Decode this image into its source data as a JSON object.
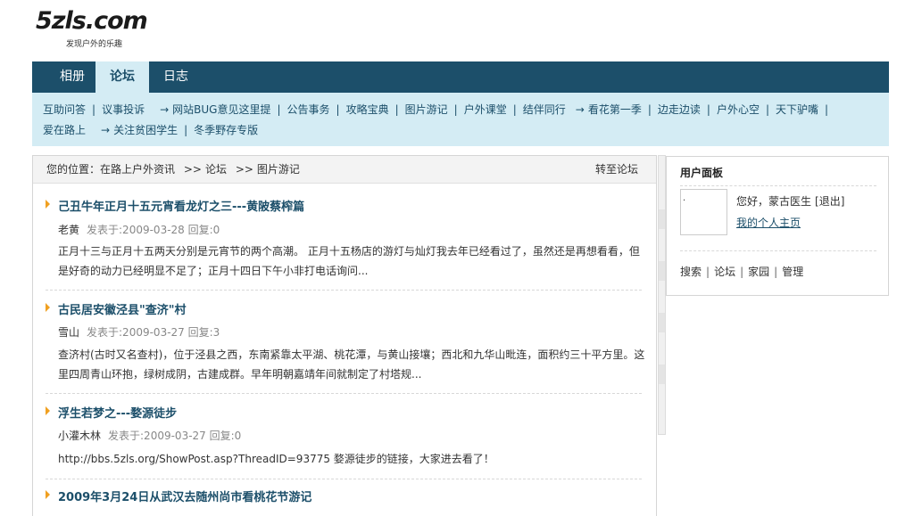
{
  "logo": {
    "text": "5zls.com",
    "slogan": "发现户外的乐趣"
  },
  "main_nav": {
    "tabs": [
      {
        "label": "相册"
      },
      {
        "label": "论坛"
      },
      {
        "label": "日志"
      }
    ],
    "active": "论坛"
  },
  "sub_nav": {
    "row1": [
      "互助问答",
      "议事投诉",
      "网站BUG意见这里提",
      "公告事务",
      "攻略宝典",
      "图片游记",
      "户外课堂",
      "结伴同行",
      "看花第一季",
      "边走边读",
      "户外心空",
      "天下驴嘴"
    ],
    "row2": [
      "爱在路上",
      "关注贫困学生",
      "冬季野存专版"
    ]
  },
  "breadcrumb": {
    "prefix": "您的位置：",
    "site": "在路上户外资讯",
    "sep": ">>",
    "forum": "论坛",
    "board": "图片游记",
    "jump": "转至论坛"
  },
  "posts": [
    {
      "title": "己丑牛年正月十五元宵看龙灯之三---黄陂蔡榨篇",
      "author": "老黄",
      "meta": "发表于:2009-03-28 回复:0",
      "excerpt": "正月十三与正月十五两天分别是元宵节的两个高潮。 正月十五杨店的游灯与灿灯我去年已经看过了，虽然还是再想看看，但是好奇的动力已经明显不足了；正月十四日下午小非打电话询问..."
    },
    {
      "title": "古民居安徽泾县\"查济\"村",
      "author": "雪山",
      "meta": "发表于:2009-03-27 回复:3",
      "excerpt": "查济村(古时又名查村)，位于泾县之西，东南紧靠太平湖、桃花潭，与黄山接壤；西北和九华山毗连，面积约三十平方里。这里四周青山环抱，绿树成阴，古建成群。早年明朝嘉靖年间就制定了村塔规..."
    },
    {
      "title": "浮生若梦之---婺源徒步",
      "author": "小灌木林",
      "meta": "发表于:2009-03-27 回复:0",
      "excerpt": "http://bbs.5zls.org/ShowPost.asp?ThreadID=93775 婺源徒步的链接，大家进去看了！"
    },
    {
      "title": "2009年3月24日从武汉去随州尚市看桃花节游记",
      "author": "",
      "meta": "",
      "excerpt": ""
    }
  ],
  "user_panel": {
    "title": "用户面板",
    "greeting": "您好，蒙古医生",
    "logout": "[退出]",
    "profile": "我的个人主页",
    "avatar_mark": ".",
    "links": [
      "搜索",
      "论坛",
      "家园",
      "管理"
    ]
  },
  "colors": {
    "nav_bg": "#1c4f6a",
    "subnav_bg": "#d4ecf4",
    "marker": "#f0a020"
  }
}
